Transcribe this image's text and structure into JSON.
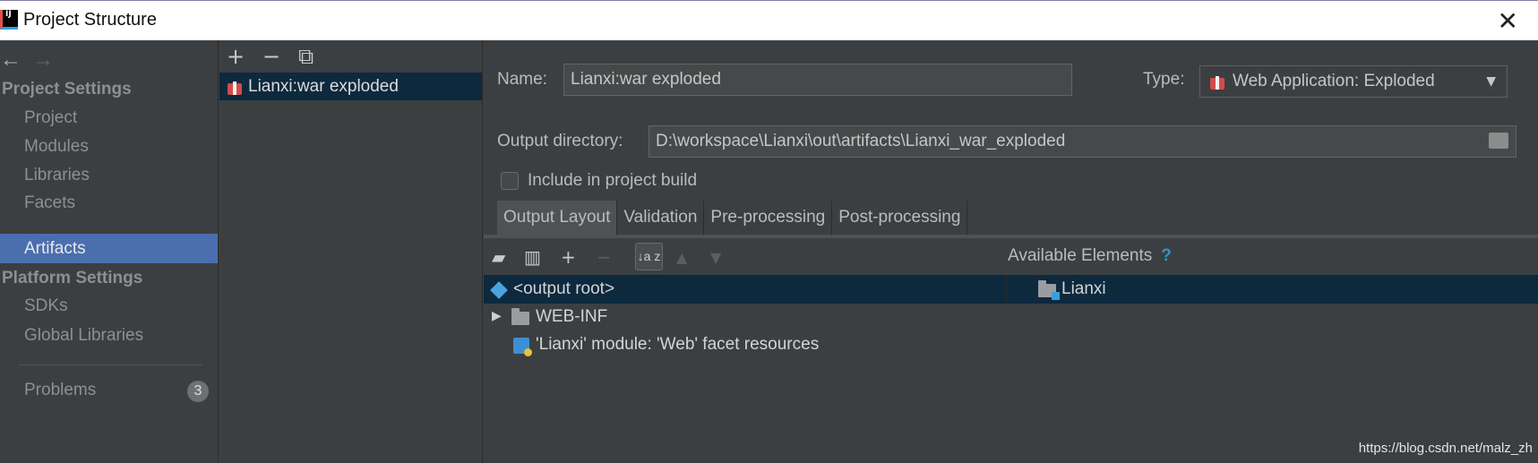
{
  "window": {
    "title": "Project Structure",
    "app_icon_text": "IJ",
    "close_icon": "close-icon"
  },
  "nav": {
    "back_icon": "←",
    "forward_icon": "→",
    "project_settings_header": "Project Settings",
    "project_items": [
      "Project",
      "Modules",
      "Libraries",
      "Facets",
      "Artifacts"
    ],
    "selected_item": "Artifacts",
    "platform_settings_header": "Platform Settings",
    "platform_items": [
      "SDKs",
      "Global Libraries"
    ],
    "problems_label": "Problems",
    "problems_count": "3"
  },
  "artifact_list": {
    "tools": [
      "+",
      "−",
      "⧉"
    ],
    "items": [
      {
        "label": "Lianxi:war exploded",
        "icon": "web-artifact-icon"
      }
    ]
  },
  "artifact": {
    "name_label": "Name:",
    "name_value": "Lianxi:war exploded",
    "type_label": "Type:",
    "type_value": "Web Application: Exploded",
    "output_dir_label": "Output directory:",
    "output_dir_value": "D:\\workspace\\Lianxi\\out\\artifacts\\Lianxi_war_exploded",
    "include_in_build_label": "Include in project build",
    "include_in_build_checked": false
  },
  "tabs": [
    "Output Layout",
    "Validation",
    "Pre-processing",
    "Post-processing"
  ],
  "active_tab": "Output Layout",
  "layout_toolbar": {
    "sort_label": "↓a z",
    "available_elements_label": "Available Elements",
    "help_label": "?"
  },
  "output_tree": [
    {
      "label": "<output root>",
      "icon": "output-root-icon",
      "selected": true
    },
    {
      "label": "WEB-INF",
      "icon": "folder-icon",
      "collapsed": true
    },
    {
      "label": "'Lianxi' module: 'Web' facet resources",
      "icon": "web-facet-icon"
    }
  ],
  "available_elements": [
    {
      "label": "Lianxi",
      "icon": "module-folder-icon",
      "selected": true
    }
  ],
  "watermark": "https://blog.csdn.net/malz_zh",
  "colors": {
    "background": "#3c3f41",
    "selection": "#4b6eaf",
    "tree_selection": "#0d293e",
    "accent": "#3592c4"
  }
}
